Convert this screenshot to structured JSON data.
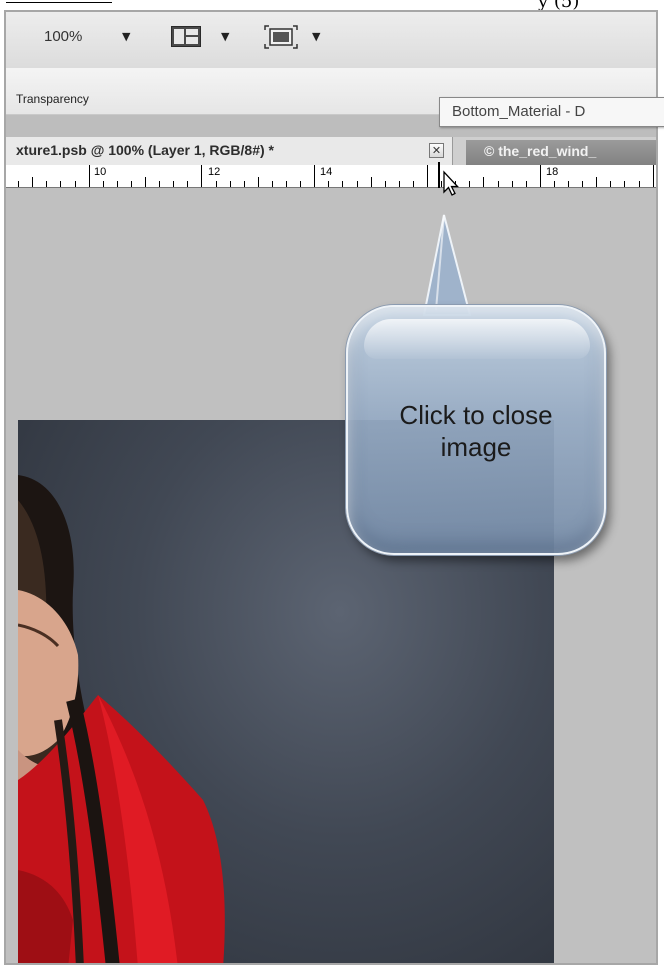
{
  "document": {
    "tail_text": "y (5)"
  },
  "toolbar": {
    "zoom": "100%",
    "arrange_icon": "arrange-documents-icon",
    "screen_mode_icon": "screen-mode-icon",
    "dropdown_glyph": "▼"
  },
  "panel": {
    "label": "Transparency"
  },
  "tabs": [
    {
      "label": "xture1.psb @ 100% (Layer 1, RGB/8#) *",
      "active": true
    },
    {
      "label": "© the_red_wind_",
      "active": false
    }
  ],
  "close_glyph": "✕",
  "tooltip": {
    "text": "Bottom_Material - D"
  },
  "ruler": {
    "labels": [
      "10",
      "12",
      "14",
      "18"
    ]
  },
  "callout": {
    "line1": "Click to close",
    "line2": "image"
  },
  "colors": {
    "callout_fill": "#9fb3cb",
    "inactive_tab": "#8e8e8e",
    "canvas_bg": "#c0c0c0"
  }
}
